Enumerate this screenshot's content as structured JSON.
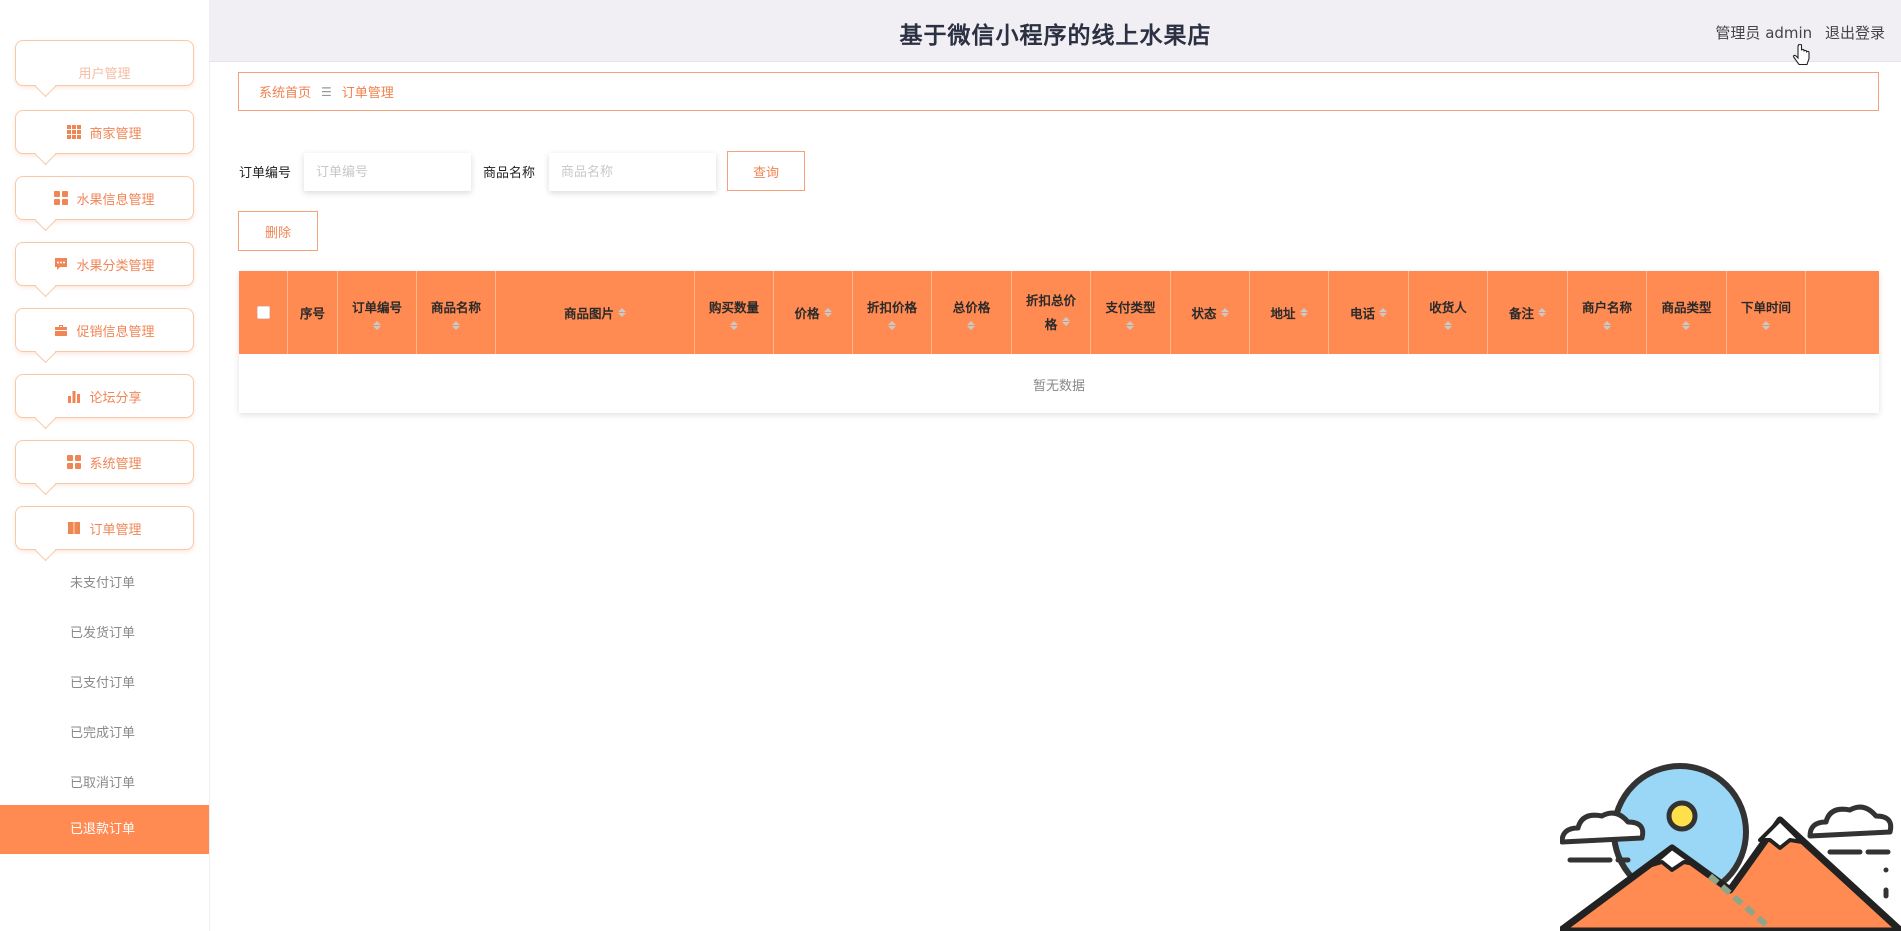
{
  "header": {
    "title": "基于微信小程序的线上水果店",
    "user_label": "管理员 admin",
    "logout_label": "退出登录"
  },
  "sidebar": {
    "partial_top_label": "用户管理",
    "menu": [
      {
        "label": "商家管理",
        "icon": "grid-icon"
      },
      {
        "label": "水果信息管理",
        "icon": "apps-icon"
      },
      {
        "label": "水果分类管理",
        "icon": "chat-icon"
      },
      {
        "label": "促销信息管理",
        "icon": "briefcase-icon"
      },
      {
        "label": "论坛分享",
        "icon": "bar-chart-icon"
      },
      {
        "label": "系统管理",
        "icon": "apps-icon"
      },
      {
        "label": "订单管理",
        "icon": "book-icon"
      }
    ],
    "sub_items": [
      "未支付订单",
      "已发货订单",
      "已支付订单",
      "已完成订单",
      "已取消订单",
      "已退款订单"
    ],
    "active_sub": "已退款订单"
  },
  "breadcrumb": {
    "home": "系统首页",
    "separator": "☰",
    "current": "订单管理"
  },
  "search": {
    "order_no_label": "订单编号",
    "order_no_placeholder": "订单编号",
    "product_name_label": "商品名称",
    "product_name_placeholder": "商品名称",
    "query_button": "查询",
    "delete_button": "删除"
  },
  "table": {
    "columns": [
      {
        "label": "序号",
        "sortable": false
      },
      {
        "label": "订单编号",
        "sortable": true
      },
      {
        "label": "商品名称",
        "sortable": true
      },
      {
        "label": "商品图片",
        "sortable": true
      },
      {
        "label": "购买数量",
        "sortable": true
      },
      {
        "label": "价格",
        "sortable": true
      },
      {
        "label": "折扣价格",
        "sortable": true
      },
      {
        "label": "总价格",
        "sortable": true
      },
      {
        "label": "折扣总价格",
        "sortable": true
      },
      {
        "label": "支付类型",
        "sortable": true
      },
      {
        "label": "状态",
        "sortable": true
      },
      {
        "label": "地址",
        "sortable": true
      },
      {
        "label": "电话",
        "sortable": true
      },
      {
        "label": "收货人",
        "sortable": true
      },
      {
        "label": "备注",
        "sortable": true
      },
      {
        "label": "商户名称",
        "sortable": true
      },
      {
        "label": "商品类型",
        "sortable": true
      },
      {
        "label": "下单时间",
        "sortable": true
      }
    ],
    "empty_text": "暂无数据"
  },
  "colors": {
    "accent": "#ff8a52",
    "accent_border": "#f3a27a",
    "header_bg": "#f1eff3"
  }
}
